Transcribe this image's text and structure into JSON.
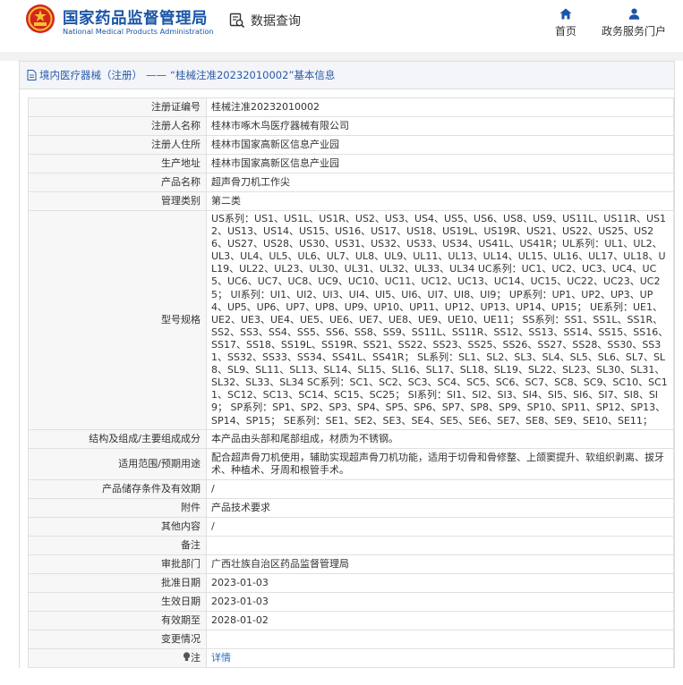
{
  "header": {
    "agency_name_cn": "国家药品监督管理局",
    "agency_name_en": "National Medical Products Administration",
    "query_label": "数据查询",
    "nav": [
      {
        "label": "首页",
        "icon": "home-icon"
      },
      {
        "label": "政务服务门户",
        "icon": "user-icon"
      }
    ]
  },
  "breadcrumb": {
    "category": "境内医疗器械（注册）",
    "separator": "——",
    "record_title": "“桂械注准20232010002”基本信息"
  },
  "fields": {
    "reg_no": {
      "label": "注册证编号",
      "value": "桂械注准20232010002"
    },
    "registrant": {
      "label": "注册人名称",
      "value": "桂林市啄木鸟医疗器械有限公司"
    },
    "registrant_addr": {
      "label": "注册人住所",
      "value": "桂林市国家高新区信息产业园"
    },
    "mfg_addr": {
      "label": "生产地址",
      "value": "桂林市国家高新区信息产业园"
    },
    "product_name": {
      "label": "产品名称",
      "value": "超声骨刀机工作尖"
    },
    "mgmt_class": {
      "label": "管理类别",
      "value": "第二类"
    },
    "model_spec": {
      "label": "型号规格",
      "value": "US系列：US1、US1L、US1R、US2、US3、US4、US5、US6、US8、US9、US11L、US11R、US12、US13、US14、US15、US16、US17、US18、US19L、US19R、US21、US22、US25、US26、US27、US28、US30、US31、US32、US33、US34、US41L、US41R；UL系列：UL1、UL2、UL3、UL4、UL5、UL6、UL7、UL8、UL9、UL11、UL13、UL14、UL15、UL16、UL17、UL18、UL19、UL22、UL23、UL30、UL31、UL32、UL33、UL34 UC系列：UC1、UC2、UC3、UC4、UC5、UC6、UC7、UC8、UC9、UC10、UC11、UC12、UC13、UC14、UC15、UC22、UC23、UC25； UI系列：UI1、UI2、UI3、UI4、UI5、UI6、UI7、UI8、UI9； UP系列：UP1、UP2、UP3、UP4、UP5、UP6、UP7、UP8、UP9、UP10、UP11、UP12、UP13、UP14、UP15； UE系列：UE1、UE2、UE3、UE4、UE5、UE6、UE7、UE8、UE9、UE10、UE11； SS系列：SS1、SS1L、SS1R、SS2、SS3、SS4、SS5、SS6、SS8、SS9、SS11L、SS11R、SS12、SS13、SS14、SS15、SS16、SS17、SS18、SS19L、SS19R、SS21、SS22、SS23、SS25、SS26、SS27、SS28、SS30、SS31、SS32、SS33、SS34、SS41L、SS41R； SL系列：SL1、SL2、SL3、SL4、SL5、SL6、SL7、SL8、SL9、SL11、SL13、SL14、SL15、SL16、SL17、SL18、SL19、SL22、SL23、SL30、SL31、SL32、SL33、SL34 SC系列：SC1、SC2、SC3、SC4、SC5、SC6、SC7、SC8、SC9、SC10、SC11、SC12、SC13、SC14、SC15、SC25； SI系列：SI1、SI2、SI3、SI4、SI5、SI6、SI7、SI8、SI9； SP系列：SP1、SP2、SP3、SP4、SP5、SP6、SP7、SP8、SP9、SP10、SP11、SP12、SP13、SP14、SP15； SE系列：SE1、SE2、SE3、SE4、SE5、SE6、SE7、SE8、SE9、SE10、SE11；"
    },
    "structure": {
      "label": "结构及组成/主要组成成分",
      "value": "本产品由头部和尾部组成，材质为不锈钢。"
    },
    "scope": {
      "label": "适用范围/预期用途",
      "value": "配合超声骨刀机使用，辅助实现超声骨刀机功能，适用于切骨和骨修整、上颌窦提升、软组织剥离、拔牙术、种植术、牙周和根管手术。"
    },
    "storage": {
      "label": "产品储存条件及有效期",
      "value": "/"
    },
    "attachment": {
      "label": "附件",
      "value": "产品技术要求"
    },
    "other": {
      "label": "其他内容",
      "value": "/"
    },
    "remark": {
      "label": "备注",
      "value": ""
    },
    "approval_dept": {
      "label": "审批部门",
      "value": "广西壮族自治区药品监督管理局"
    },
    "approval_date": {
      "label": "批准日期",
      "value": "2023-01-03"
    },
    "effective_date": {
      "label": "生效日期",
      "value": "2023-01-03"
    },
    "expiry_date": {
      "label": "有效期至",
      "value": "2028-01-02"
    },
    "change_status": {
      "label": "变更情况",
      "value": ""
    },
    "note": {
      "label": "注",
      "value": "详情"
    }
  },
  "colors": {
    "brand_blue": "#1a56a8",
    "link_blue": "#2a6ebd",
    "label_bg": "#f7f7f7",
    "emblem_red": "#d6251f",
    "emblem_gold": "#f2c230"
  }
}
